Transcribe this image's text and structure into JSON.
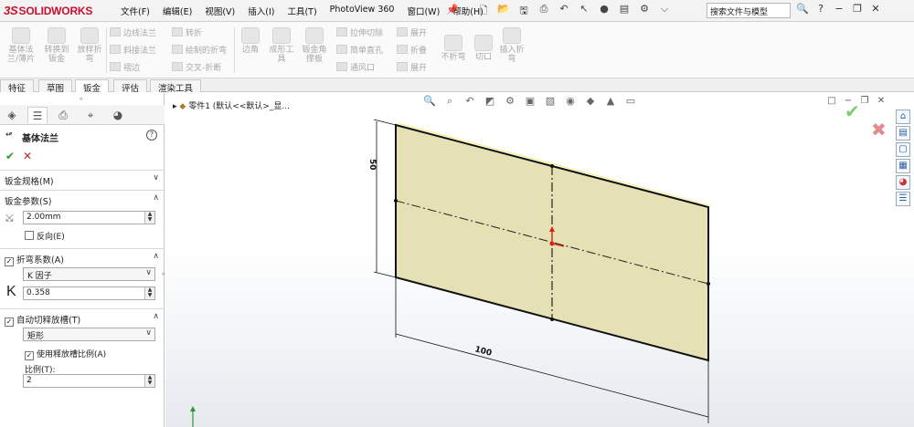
{
  "app": {
    "logo_mark": "3S",
    "logo_text": "SOLIDWORKS"
  },
  "menu": [
    "文件(F)",
    "编辑(E)",
    "视图(V)",
    "插入(I)",
    "工具(T)",
    "PhotoView 360",
    "窗口(W)",
    "帮助(H)"
  ],
  "search": {
    "label": "搜索文件与模型"
  },
  "ribbon": {
    "base_flange": "基体法\n兰/薄片",
    "convert_sheet": "转换到\n钣金",
    "lofted_bend": "放样折\n弯",
    "edge_flange": "边线法兰",
    "miter_flange": "斜接法兰",
    "hem": "褶边",
    "jog": "转折",
    "sketched_bend": "绘制的折弯",
    "cross_break": "交叉-折断",
    "corner": "边角",
    "forming_tool": "成形工\n具",
    "sheet_gusset": "钣金角\n撑板",
    "extruded_cut": "拉伸切除",
    "simple_hole": "简单直孔",
    "vent": "通风口",
    "unfold": "展开",
    "fold": "折叠",
    "flatten": "展开",
    "no_bends": "不折弯",
    "rip": "切口",
    "insert_bends": "插入折\n弯"
  },
  "tabs": [
    "特征",
    "草图",
    "钣金",
    "评估",
    "渲染工具"
  ],
  "tabs_active": "钣金",
  "property_manager": {
    "title": "基体法兰",
    "help": "?",
    "ok": "✔",
    "cancel": "✕",
    "sheet_gauges": "钣金规格(M)",
    "sheet_params": "钣金参数(S)",
    "thickness": "2.00mm",
    "reverse": "反向(E)",
    "bend_allowance": "折弯系数(A)",
    "bend_type": "K 因子",
    "k_label": "K",
    "k_value": "0.358",
    "auto_relief": "自动切释放槽(T)",
    "relief_type": "矩形",
    "use_ratio": "使用释放槽比例(A)",
    "ratio_label": "比例(T):",
    "ratio_value": "2"
  },
  "viewport": {
    "tree_item": "零件1  (默认<<默认>_显...",
    "dim_width": "100",
    "dim_height": "50"
  },
  "colors": {
    "plate": "#e5e1b4",
    "plate_edge": "#f5ec6a",
    "accent_red": "#c8102e"
  }
}
